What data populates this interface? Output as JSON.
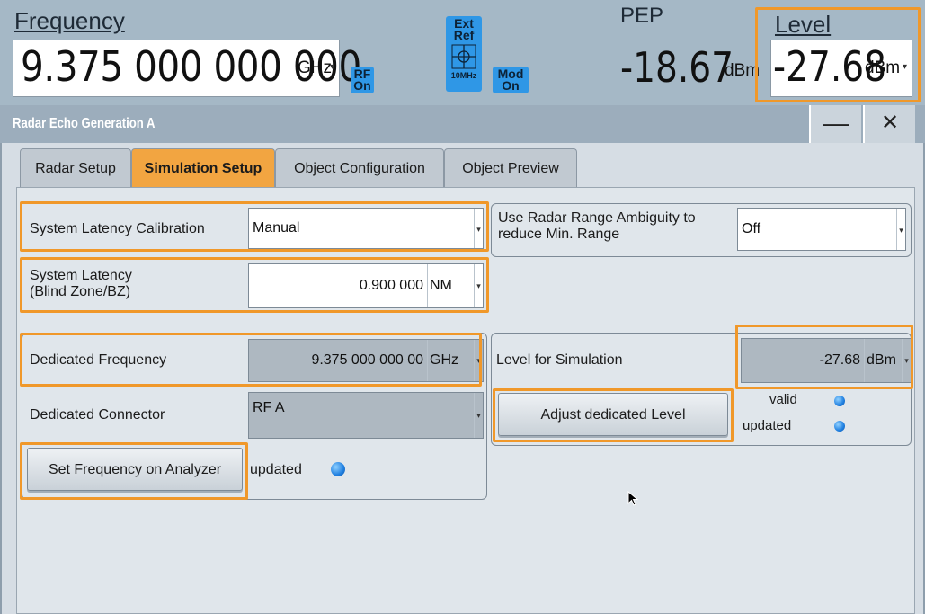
{
  "topbar": {
    "frequency_label": "Frequency",
    "frequency_value": "9.375 000 000 000",
    "frequency_unit": "GHz",
    "rf_button": {
      "line1": "RF",
      "line2": "On"
    },
    "ext_ref": {
      "line1": "Ext",
      "line2": "Ref",
      "sub": "10MHz"
    },
    "mod_button": {
      "line1": "Mod",
      "line2": "On"
    },
    "pep_label": "PEP",
    "pep_value": "-18.67",
    "pep_unit": "dBm",
    "level_label": "Level",
    "level_value": "-27.68",
    "level_unit": "dBm"
  },
  "dialog": {
    "title": "Radar Echo Generation A",
    "minimize_glyph": "—",
    "close_glyph": "✕",
    "tabs": [
      {
        "label": "Radar Setup",
        "active": false
      },
      {
        "label": "Simulation Setup",
        "active": true
      },
      {
        "label": "Object Configuration",
        "active": false
      },
      {
        "label": "Object Preview",
        "active": false
      }
    ]
  },
  "simulation": {
    "latency_calibration": {
      "label": "System Latency Calibration",
      "value": "Manual"
    },
    "range_ambiguity": {
      "label_line1": "Use Radar Range Ambiguity to",
      "label_line2": "reduce Min. Range",
      "value": "Off"
    },
    "system_latency": {
      "label_line1": "System Latency",
      "label_line2": "(Blind Zone/BZ)",
      "value": "0.900 000",
      "unit": "NM"
    },
    "dedicated_frequency": {
      "label": "Dedicated Frequency",
      "value": "9.375 000 000 00",
      "unit": "GHz"
    },
    "dedicated_connector": {
      "label": "Dedicated Connector",
      "value": "RF A"
    },
    "set_frequency_button": "Set Frequency on Analyzer",
    "frequency_status": "updated",
    "level_for_simulation": {
      "label": "Level for Simulation",
      "value": "-27.68",
      "unit": "dBm"
    },
    "adjust_level_button": "Adjust dedicated Level",
    "level_status": [
      "valid",
      "updated"
    ]
  },
  "colors": {
    "topbar_bg": "#a5b8c6",
    "highlight": "#f0982a",
    "active_tab": "#f2a541",
    "led_blue": "#1f7fe0"
  },
  "icons": {
    "dropdown": "small-down-arrow",
    "ext_ref": "reference-crosshair-icon",
    "pointer": "mouse-cursor-icon"
  }
}
